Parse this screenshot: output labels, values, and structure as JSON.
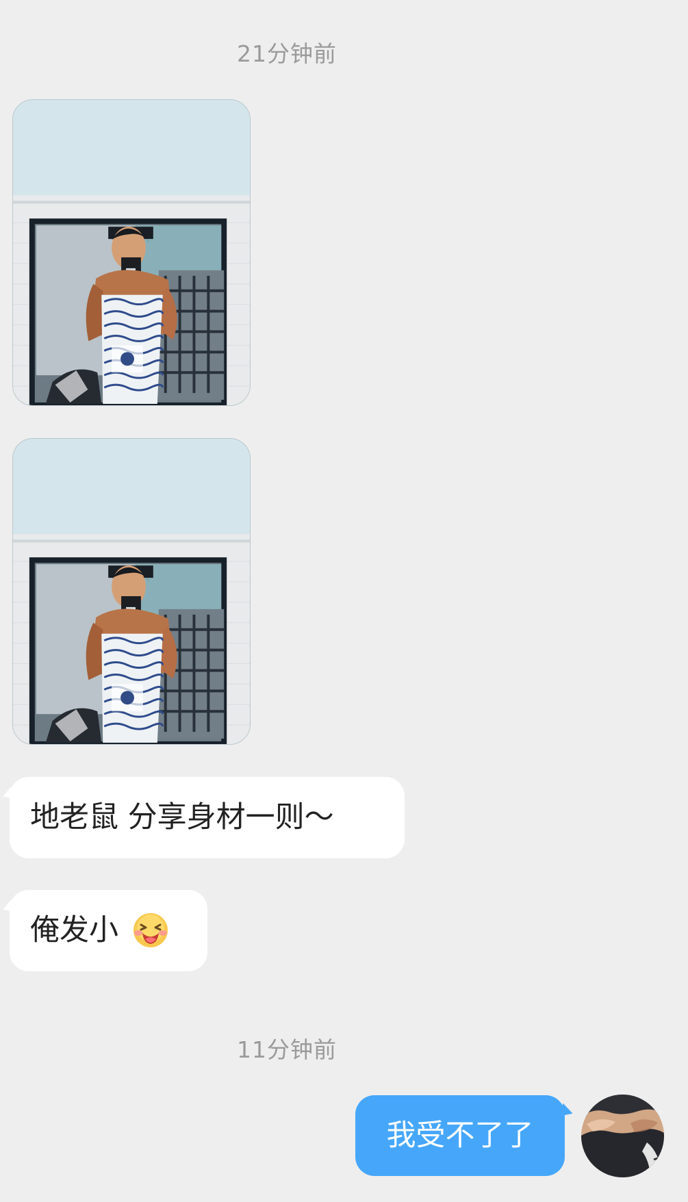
{
  "chat": {
    "time_divider_1": "21分钟前",
    "time_divider_2": "11分钟前",
    "message_1": "地老鼠  分享身材一则～",
    "message_2": "俺发小",
    "message_3": "我受不了了"
  },
  "icons": {
    "emoji": "laughing-crying-face",
    "avatar": "user-avatar"
  },
  "colors": {
    "background": "#eeeeee",
    "incoming_bubble": "#ffffff",
    "outgoing_bubble": "#46a7fa",
    "timestamp": "#9a9a9a"
  }
}
